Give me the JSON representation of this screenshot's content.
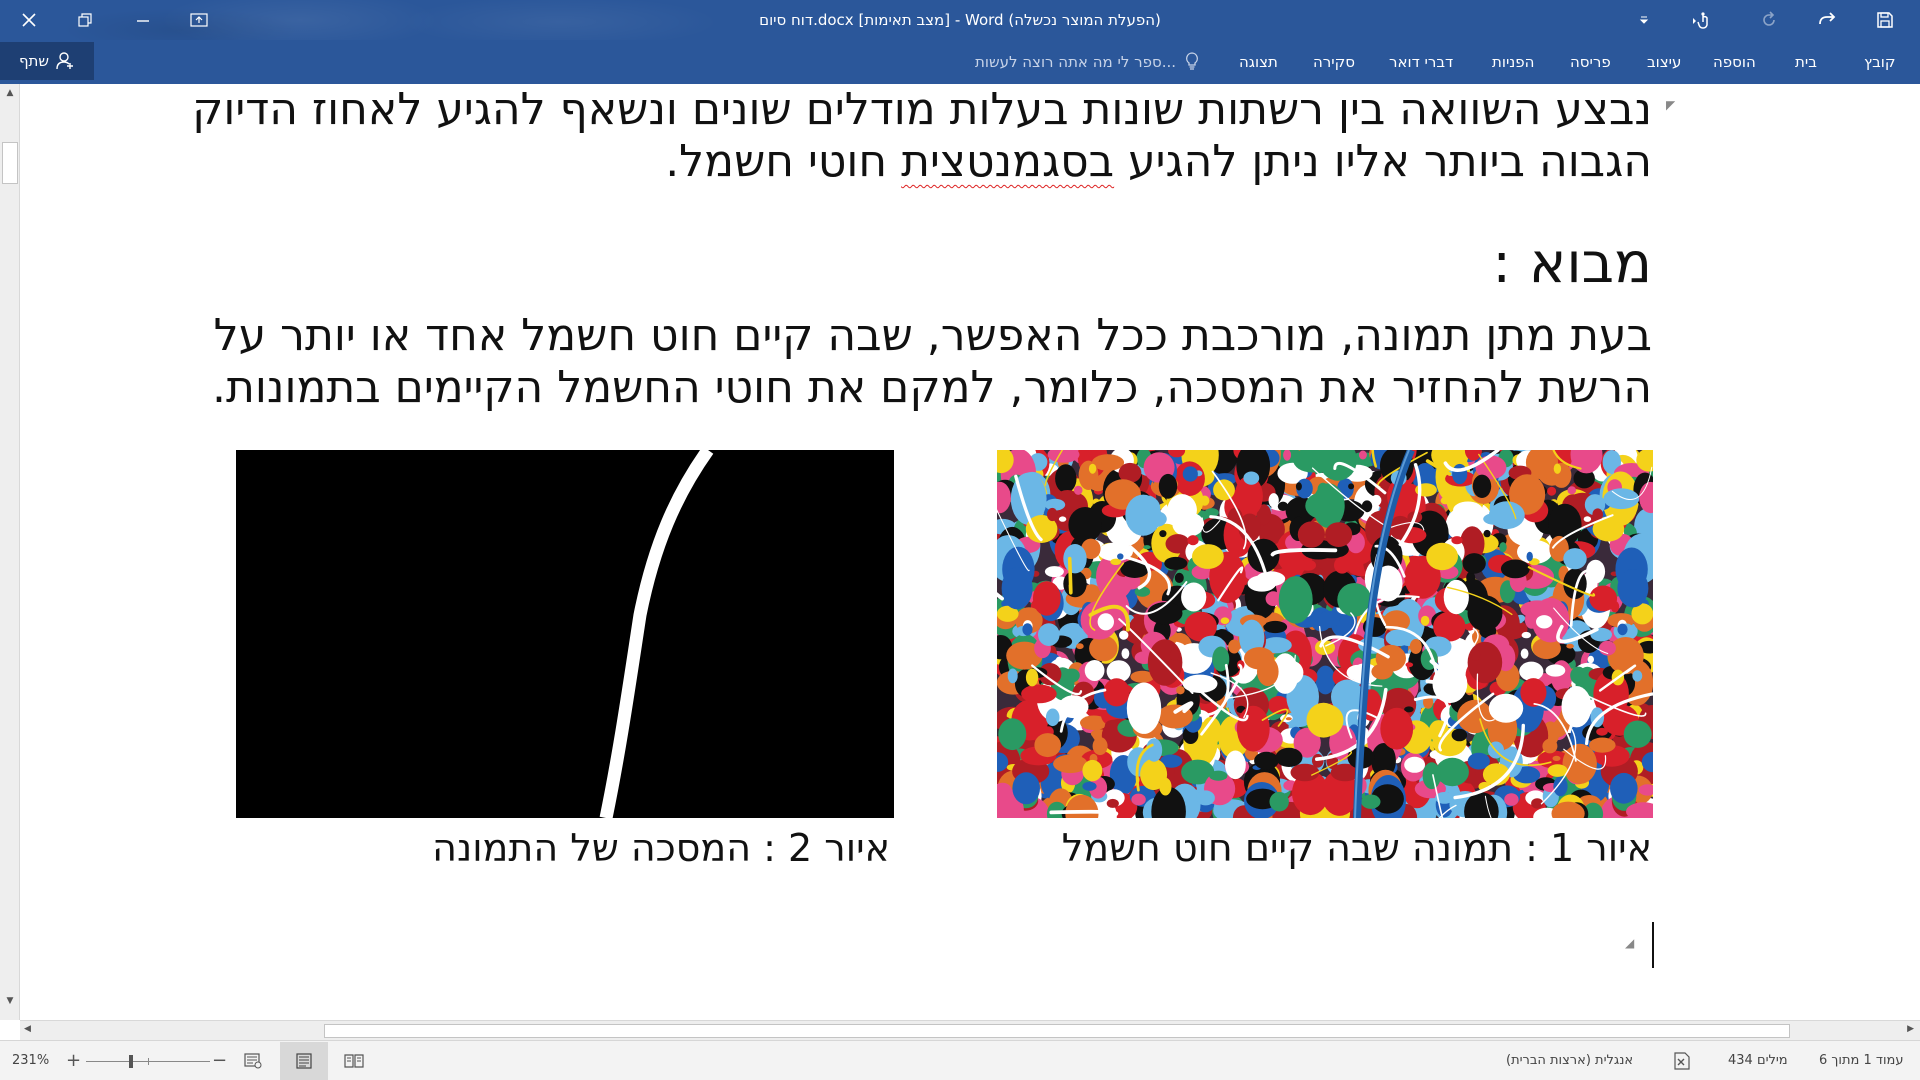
{
  "window": {
    "title": "דוח סיום.docx [מצב תאימות] - Word (הפעלת המוצר נכשלה)"
  },
  "titlebar": {
    "close_icon": "close-icon",
    "restore_icon": "restore-icon",
    "minimize_icon": "minimize-icon",
    "ribbon_display_icon": "ribbon-display-options-icon",
    "save_icon": "save-icon",
    "undo_icon": "undo-icon",
    "redo_icon": "redo-icon",
    "touch_icon": "touch-mode-icon",
    "customize_icon": "customize-qat-icon"
  },
  "ribbon": {
    "tabs": [
      "קובץ",
      "בית",
      "הוספה",
      "עיצוב",
      "פריסה",
      "הפניות",
      "דברי דואר",
      "סקירה",
      "תצוגה"
    ],
    "tell_me": "ספר לי מה אתה רוצה לעשות...",
    "share": "שתף"
  },
  "document": {
    "para1_line1": "נבצע השוואה בין רשתות שונות בעלות מודלים שונים ונשאף להגיע לאחוז הדיוק",
    "para1_line2_a": "הגבוה ביותר אליו ניתן להגיע ",
    "para1_line2_b": "בסגמנטצית",
    "para1_line2_c": " חוטי חשמל.",
    "heading": "מבוא :",
    "para2_line1": "בעת מתן תמונה, מורכבת ככל האפשר, שבה קיים חוט חשמל אחד או יותר על",
    "para2_line2": "הרשת להחזיר את המסכה, כלומר, למקם את חוטי החשמל הקיימים בתמונות.",
    "caption1": "איור 1 : תמונה שבה קיים חוט חשמל",
    "caption2": "איור 2 : המסכה של התמונה"
  },
  "statusbar": {
    "page": "עמוד 1 מתוך 6",
    "words": "434 מילים",
    "language": "אנגלית (ארצות הברית)",
    "zoom": "231%",
    "zoom_level_fraction": 0.36
  }
}
